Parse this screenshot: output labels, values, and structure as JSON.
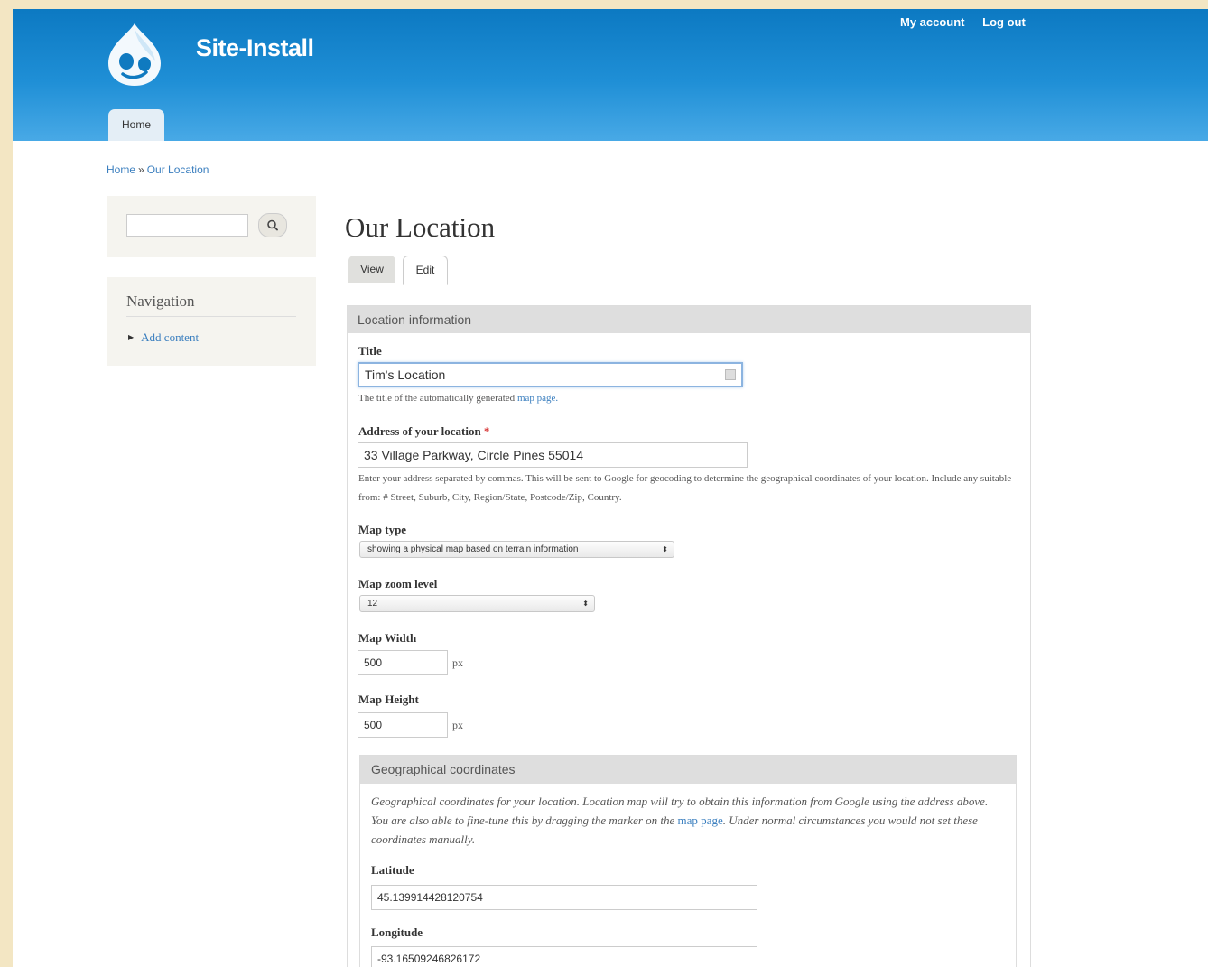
{
  "site": {
    "name": "Site-Install",
    "logo_icon": "drupal-drop-icon"
  },
  "user_menu": {
    "my_account": "My account",
    "log_out": "Log out"
  },
  "main_menu": {
    "home_tab": "Home"
  },
  "breadcrumb": {
    "home": "Home",
    "separator": "»",
    "current": "Our Location"
  },
  "sidebar": {
    "search": {
      "input_value": "",
      "button_icon": "search-icon"
    },
    "navigation": {
      "title": "Navigation",
      "items": [
        {
          "label": "Add content"
        }
      ]
    }
  },
  "page": {
    "title": "Our Location",
    "tabs": [
      {
        "label": "View"
      },
      {
        "label": "Edit",
        "active": true
      }
    ]
  },
  "form": {
    "fieldset_legend": "Location information",
    "title": {
      "label": "Title",
      "value": "Tim's Location",
      "description_prefix": "The title of the automatically generated",
      "description_link": "map page."
    },
    "address": {
      "label": "Address of your location",
      "required_mark": "*",
      "value": "33 Village Parkway, Circle Pines 55014",
      "description": "Enter your address separated by commas. This will be sent to Google for geocoding to determine the geographical coordinates of your location. Include any suitable from: # Street, Suburb, City, Region/State, Postcode/Zip, Country."
    },
    "map_type": {
      "label": "Map type",
      "selected": "showing a physical map based on terrain information"
    },
    "map_zoom": {
      "label": "Map zoom level",
      "selected": "12"
    },
    "map_width": {
      "label": "Map Width",
      "value": "500",
      "unit": "px"
    },
    "map_height": {
      "label": "Map Height",
      "value": "500",
      "unit": "px"
    },
    "geo": {
      "legend": "Geographical coordinates",
      "description_part1": "Geographical coordinates for your location. Location map will try to obtain this information from Google using the address above. You are also able to fine-tune this by dragging the marker on the",
      "description_link": "map page",
      "description_part2": ". Under normal circumstances you would not set these coordinates manually.",
      "latitude": {
        "label": "Latitude",
        "value": "45.1399144281207​54"
      },
      "longitude": {
        "label": "Longitude",
        "value": "-93.16509246826172"
      }
    }
  },
  "colors": {
    "header_top": "#0c79c2",
    "header_bottom": "#48a9e6",
    "link": "#3b7fbf",
    "backdrop": "#f3e6c3"
  }
}
